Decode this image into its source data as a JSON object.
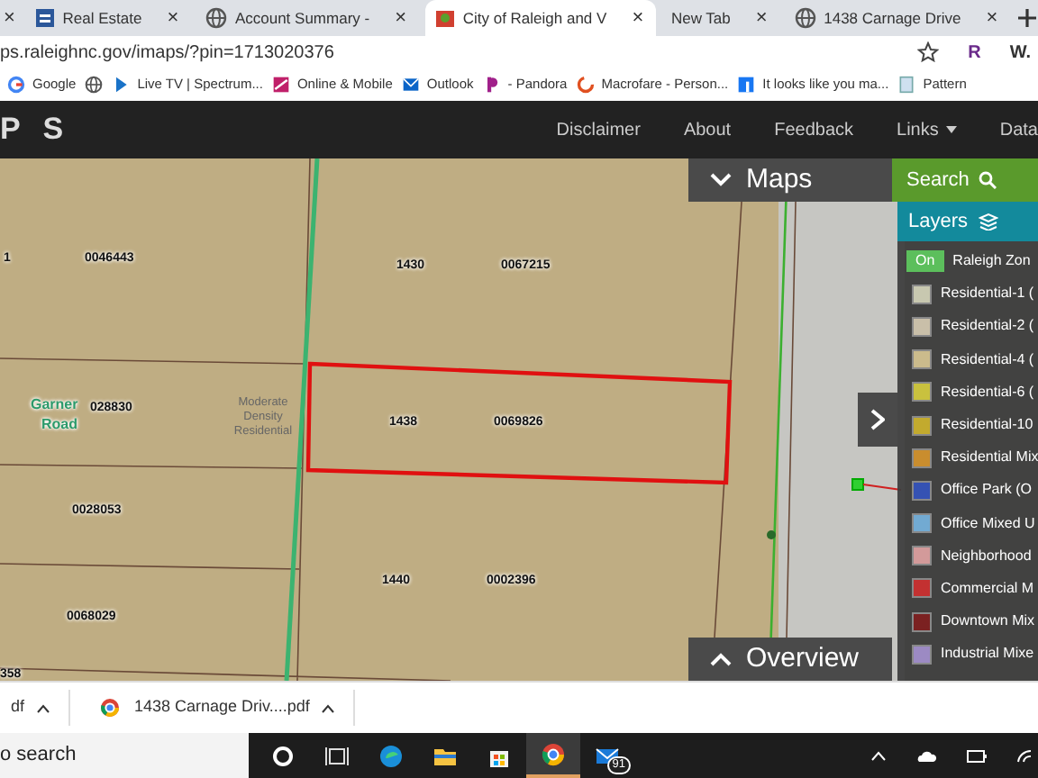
{
  "browser": {
    "edge_tab_close": "×",
    "tabs": [
      {
        "title": "Real Estate",
        "close": "×",
        "selected": false
      },
      {
        "title": "Account Summary -",
        "close": "×",
        "selected": false
      },
      {
        "title": "City of Raleigh and V",
        "close": "×",
        "selected": true
      },
      {
        "title": "New Tab",
        "close": "×",
        "selected": false
      },
      {
        "title": "1438 Carnage Drive",
        "close": "×",
        "selected": false
      }
    ],
    "address": "ps.raleighnc.gov/imaps/?pin=1713020376",
    "profile": "R",
    "extension": "W.",
    "bookmarks": [
      "Google",
      "Live TV | Spectrum...",
      "Online & Mobile",
      "Outlook",
      "- Pandora",
      "Macrofare - Person...",
      "It looks like you ma...",
      "Pattern"
    ]
  },
  "app": {
    "brand": "P S",
    "nav": [
      "Disclaimer",
      "About",
      "Feedback",
      "Links",
      "Data"
    ],
    "map": {
      "labels": [
        {
          "text": "1",
          "kind": "parcel"
        },
        {
          "text": "0046443",
          "kind": "parcel"
        },
        {
          "text": "1430",
          "kind": "parcel"
        },
        {
          "text": "0067215",
          "kind": "parcel"
        },
        {
          "text": "Garner",
          "kind": "road"
        },
        {
          "text": "Road",
          "kind": "road"
        },
        {
          "text": "028830",
          "kind": "parcel"
        },
        {
          "text": "Moderate Density Residential",
          "kind": "zone"
        },
        {
          "text": "1438",
          "kind": "parcel"
        },
        {
          "text": "0069826",
          "kind": "parcel"
        },
        {
          "text": "0028053",
          "kind": "parcel"
        },
        {
          "text": "1440",
          "kind": "parcel"
        },
        {
          "text": "0002396",
          "kind": "parcel"
        },
        {
          "text": "0068029",
          "kind": "parcel"
        },
        {
          "text": "358",
          "kind": "parcel"
        }
      ]
    },
    "maps_panel": {
      "title": "Maps",
      "expanded": false
    },
    "overview_panel": {
      "title": "Overview",
      "expanded": false
    },
    "search_tab": "Search",
    "layers": {
      "title": "Layers",
      "toggle": "On",
      "on": true,
      "layer_name": "Raleigh Zon",
      "legend": [
        {
          "label": "Residential-1 (",
          "color": "#c8c8b0"
        },
        {
          "label": "Residential-2 (",
          "color": "#c9bfa9"
        },
        {
          "label": "Residential-4 (",
          "color": "#cbbb8c"
        },
        {
          "label": "Residential-6 (",
          "color": "#c9c13e"
        },
        {
          "label": "Residential-10",
          "color": "#c2aa2e"
        },
        {
          "label": "Residential Mix",
          "color": "#c98d2e"
        },
        {
          "label": "Office Park (O",
          "color": "#3552b3"
        },
        {
          "label": "Office Mixed U",
          "color": "#72aad2"
        },
        {
          "label": "Neighborhood",
          "color": "#d39a9a"
        },
        {
          "label": "Commercial M",
          "color": "#c33131"
        },
        {
          "label": "Downtown Mix",
          "color": "#7b2121"
        },
        {
          "label": "Industrial Mixe",
          "color": "#9c8ac3"
        }
      ]
    }
  },
  "downloads": [
    "df",
    "1438 Carnage Driv....pdf"
  ],
  "taskbar": {
    "search": "o search",
    "apps": [
      {
        "active": false
      },
      {
        "active": false
      },
      {
        "active": false
      },
      {
        "active": false
      },
      {
        "active": false
      },
      {
        "active": true
      },
      {
        "active": false,
        "badge": "91"
      }
    ]
  }
}
